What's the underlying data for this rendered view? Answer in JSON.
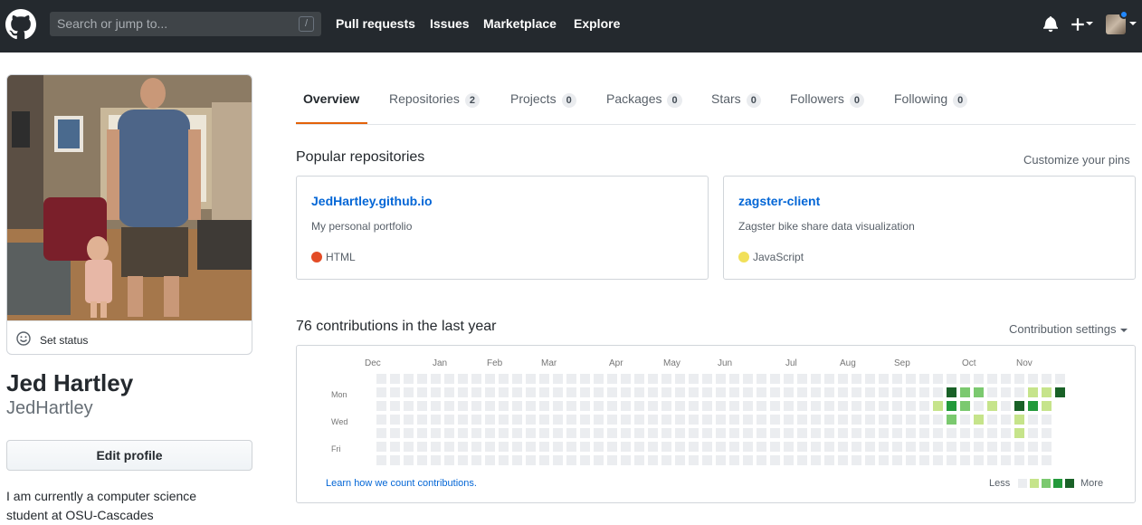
{
  "header": {
    "search_placeholder": "Search or jump to...",
    "search_shortcut": "/",
    "nav": [
      "Pull requests",
      "Issues",
      "Marketplace",
      "Explore"
    ],
    "icons": [
      "github-logo-icon",
      "bell-icon",
      "plus-icon",
      "avatar"
    ]
  },
  "profile": {
    "set_status": "Set status",
    "full_name": "Jed Hartley",
    "username": "JedHartley",
    "edit_button": "Edit profile",
    "bio": "I am currently a computer science student at OSU-Cascades"
  },
  "tabs": [
    {
      "label": "Overview",
      "count": null,
      "active": true
    },
    {
      "label": "Repositories",
      "count": "2"
    },
    {
      "label": "Projects",
      "count": "0"
    },
    {
      "label": "Packages",
      "count": "0"
    },
    {
      "label": "Stars",
      "count": "0"
    },
    {
      "label": "Followers",
      "count": "0"
    },
    {
      "label": "Following",
      "count": "0"
    }
  ],
  "popular": {
    "title": "Popular repositories",
    "customize": "Customize your pins",
    "repos": [
      {
        "name": "JedHartley.github.io",
        "description": "My personal portfolio",
        "language": "HTML",
        "language_color": "#e34c26"
      },
      {
        "name": "zagster-client",
        "description": "Zagster bike share data visualization",
        "language": "JavaScript",
        "language_color": "#f1e05a"
      }
    ]
  },
  "contributions": {
    "title": "76 contributions in the last year",
    "settings": "Contribution settings",
    "months": [
      "Dec",
      "Jan",
      "Feb",
      "Mar",
      "Apr",
      "May",
      "Jun",
      "Jul",
      "Aug",
      "Sep",
      "Oct",
      "Nov"
    ],
    "weekdays": [
      "Mon",
      "Wed",
      "Fri"
    ],
    "learn_link": "Learn how we count contributions.",
    "legend_less": "Less",
    "legend_more": "More",
    "colors": [
      "#ebedf0",
      "#c6e48b",
      "#7bc96f",
      "#239a3b",
      "#196127"
    ]
  }
}
